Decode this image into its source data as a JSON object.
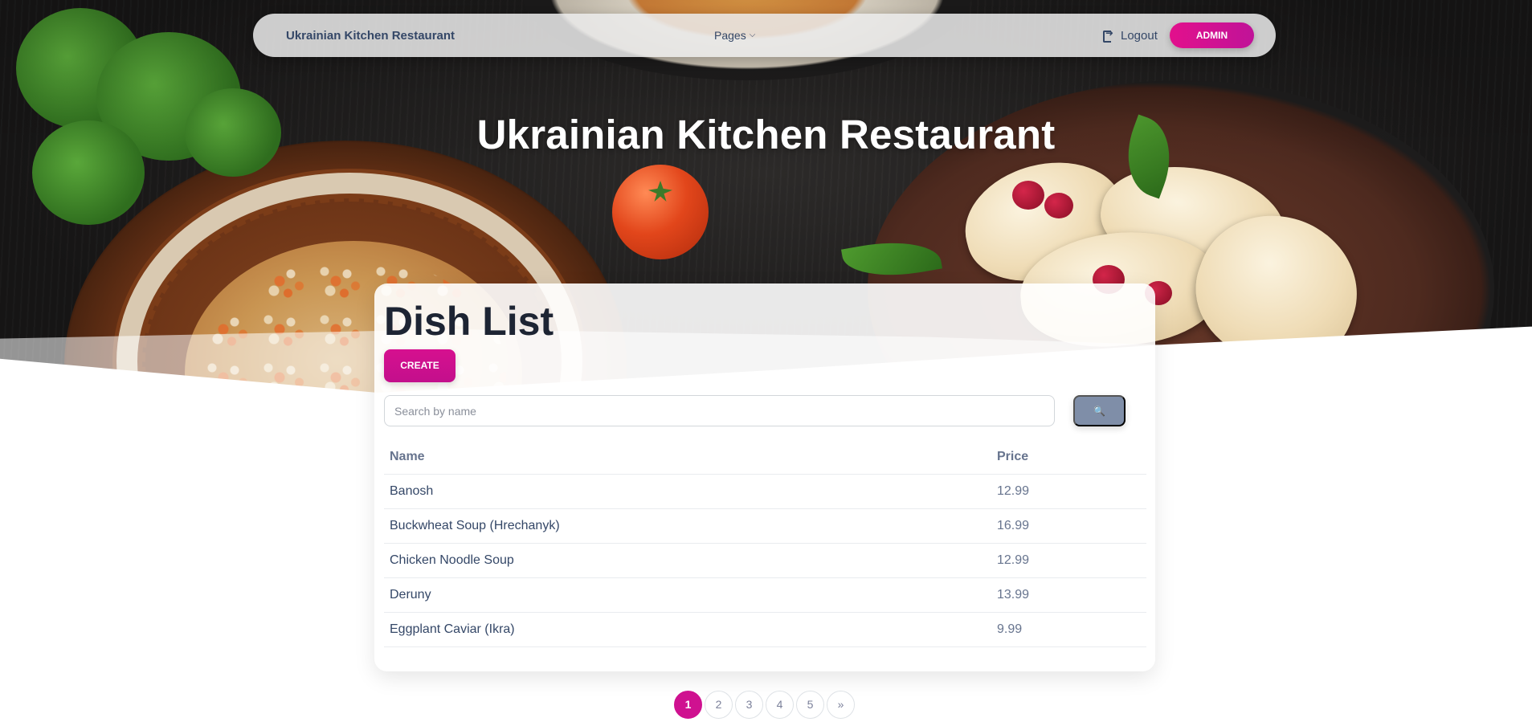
{
  "navbar": {
    "brand": "Ukrainian Kitchen Restaurant",
    "pages_label": "Pages",
    "logout_label": "Logout",
    "admin_label": "ADMIN",
    "accent_color": "#d6108f"
  },
  "hero": {
    "title": "Ukrainian Kitchen Restaurant"
  },
  "dish_list": {
    "title": "Dish List",
    "create_label": "CREATE",
    "search": {
      "placeholder": "Search by name",
      "value": "",
      "button_icon": "search-icon"
    },
    "columns": [
      "Name",
      "Price"
    ],
    "rows": [
      {
        "name": "Banosh",
        "price": "12.99"
      },
      {
        "name": "Buckwheat Soup (Hrechanyk)",
        "price": "16.99"
      },
      {
        "name": "Chicken Noodle Soup",
        "price": "12.99"
      },
      {
        "name": "Deruny",
        "price": "13.99"
      },
      {
        "name": "Eggplant Caviar (Ikra)",
        "price": "9.99"
      }
    ]
  },
  "pagination": {
    "pages": [
      "1",
      "2",
      "3",
      "4",
      "5"
    ],
    "active": "1",
    "next_label": "»"
  }
}
